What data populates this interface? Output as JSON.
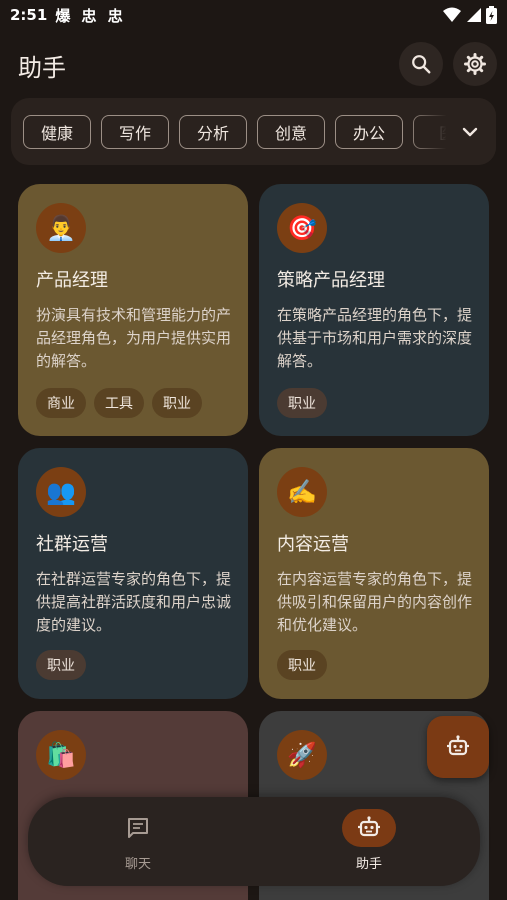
{
  "status_bar": {
    "time": "2:51",
    "notifications": "爆 忠 忠"
  },
  "app_bar": {
    "title": "助手",
    "search_icon": "search-icon",
    "settings_icon": "gear-icon"
  },
  "filters": {
    "chips": [
      "健康",
      "写作",
      "分析",
      "创意",
      "办公",
      "医"
    ],
    "expand_icon": "chevron-down-icon"
  },
  "cards": [
    {
      "emoji": "👨‍💼",
      "title": "产品经理",
      "description": "扮演具有技术和管理能力的产品经理角色，为用户提供实用的解答。",
      "tags": [
        "商业",
        "工具",
        "职业"
      ]
    },
    {
      "emoji": "🎯",
      "title": "策略产品经理",
      "description": "在策略产品经理的角色下，提供基于市场和用户需求的深度解答。",
      "tags": [
        "职业"
      ]
    },
    {
      "emoji": "👥",
      "title": "社群运营",
      "description": "在社群运营专家的角色下，提供提高社群活跃度和用户忠诚度的建议。",
      "tags": [
        "职业"
      ]
    },
    {
      "emoji": "✍️",
      "title": "内容运营",
      "description": "在内容运营专家的角色下，提供吸引和保留用户的内容创作和优化建议。",
      "tags": [
        "职业"
      ]
    },
    {
      "emoji": "🛍️"
    },
    {
      "emoji": "🚀"
    }
  ],
  "fab": {
    "icon": "robot-icon"
  },
  "bottom_nav": {
    "items": [
      {
        "label": "聊天",
        "icon": "chat-icon",
        "active": false
      },
      {
        "label": "助手",
        "icon": "robot-icon",
        "active": true
      }
    ]
  },
  "colors": {
    "background": "#1d1714",
    "accent": "#7b3a14",
    "card_gold": "#6b5831",
    "card_slate": "#283339"
  }
}
